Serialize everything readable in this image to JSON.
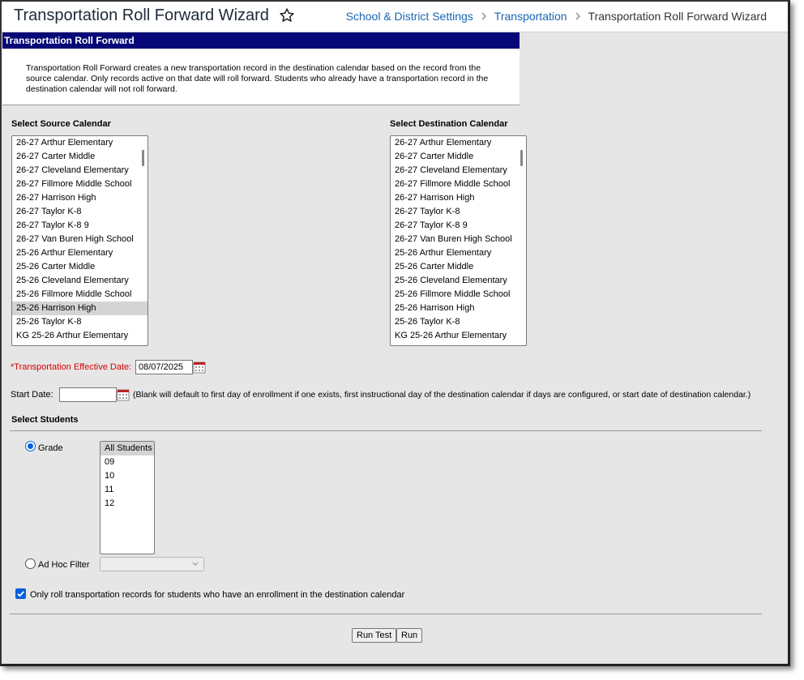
{
  "header": {
    "title": "Transportation Roll Forward Wizard",
    "breadcrumb": [
      "School & District Settings",
      "Transportation",
      "Transportation Roll Forward Wizard"
    ]
  },
  "banner": {
    "title": "Transportation Roll Forward"
  },
  "intro": {
    "text": "Transportation Roll Forward creates a new transportation record in the destination calendar based on the record from the source calendar. Only records active on that date will roll forward. Students who already have a transportation record in the destination calendar will not roll forward."
  },
  "source": {
    "label": "Select Source Calendar",
    "options": [
      "26-27 Arthur Elementary",
      "26-27 Carter Middle",
      "26-27 Cleveland Elementary",
      "26-27 Fillmore Middle School",
      "26-27 Harrison High",
      "26-27 Taylor K-8",
      "26-27 Taylor K-8 9",
      "26-27 Van Buren High School",
      "25-26 Arthur Elementary",
      "25-26 Carter Middle",
      "25-26 Cleveland Elementary",
      "25-26 Fillmore Middle School",
      "25-26 Harrison High",
      "25-26 Taylor K-8",
      "KG 25-26 Arthur Elementary"
    ],
    "selected": "25-26 Harrison High"
  },
  "destination": {
    "label": "Select Destination Calendar",
    "options": [
      "26-27 Arthur Elementary",
      "26-27 Carter Middle",
      "26-27 Cleveland Elementary",
      "26-27 Fillmore Middle School",
      "26-27 Harrison High",
      "26-27 Taylor K-8",
      "26-27 Taylor K-8 9",
      "26-27 Van Buren High School",
      "25-26 Arthur Elementary",
      "25-26 Carter Middle",
      "25-26 Cleveland Elementary",
      "25-26 Fillmore Middle School",
      "25-26 Harrison High",
      "25-26 Taylor K-8",
      "KG 25-26 Arthur Elementary"
    ]
  },
  "effective_date": {
    "required_mark": "*",
    "label": "Transportation Effective Date:",
    "value": "08/07/2025"
  },
  "start_date": {
    "label": "Start Date:",
    "value": "",
    "hint": "(Blank will default to first day of enrollment if one exists, first instructional day of the destination calendar if days are configured, or start date of destination calendar.)"
  },
  "students": {
    "label": "Select Students",
    "grade_label": "Grade",
    "grade_options": [
      "All Students",
      "09",
      "10",
      "11",
      "12"
    ],
    "grade_selected": "All Students",
    "adhoc_label": "Ad Hoc Filter",
    "adhoc_value": ""
  },
  "enrollment_checkbox": {
    "label": "Only roll transportation records for students who have an enrollment in the destination calendar",
    "checked": true
  },
  "buttons": {
    "run_test": "Run Test",
    "run": "Run"
  },
  "colors": {
    "banner": "#050876",
    "link": "#1a66b3",
    "accent": "#0a5fd8",
    "required": "#d40000"
  }
}
